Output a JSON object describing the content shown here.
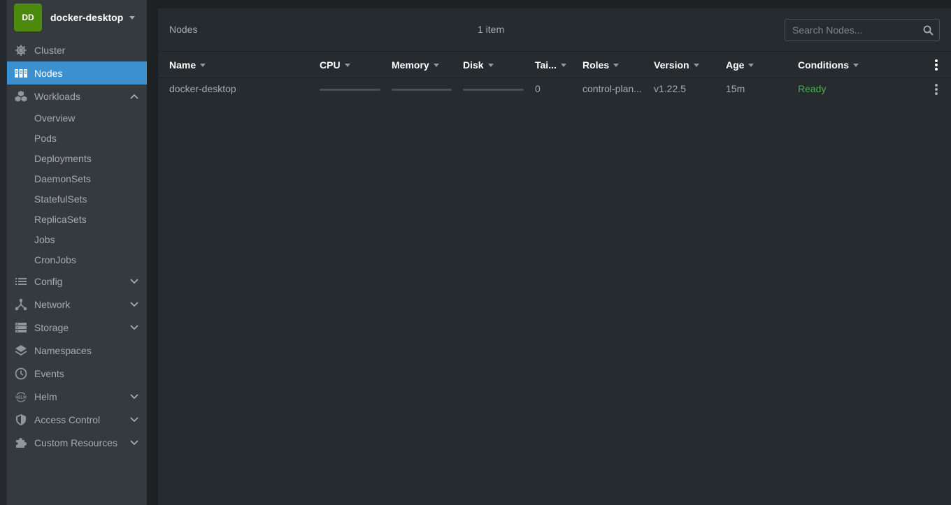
{
  "colors": {
    "avatar_bg": "#4c8a0e",
    "active_bg": "#3d90ce",
    "ready": "#4caf50"
  },
  "cluster": {
    "avatar": "DD",
    "name": "docker-desktop"
  },
  "sidebar": {
    "items": [
      {
        "label": "Cluster",
        "icon": "helm-wheel-icon"
      },
      {
        "label": "Nodes",
        "icon": "nodes-icon",
        "active": true
      },
      {
        "label": "Workloads",
        "icon": "workloads-icon",
        "expanded": true
      },
      {
        "label": "Config",
        "icon": "list-icon"
      },
      {
        "label": "Network",
        "icon": "network-icon"
      },
      {
        "label": "Storage",
        "icon": "storage-icon"
      },
      {
        "label": "Namespaces",
        "icon": "layers-icon"
      },
      {
        "label": "Events",
        "icon": "clock-icon"
      },
      {
        "label": "Helm",
        "icon": "helm-icon"
      },
      {
        "label": "Access Control",
        "icon": "shield-icon"
      },
      {
        "label": "Custom Resources",
        "icon": "puzzle-icon"
      }
    ],
    "workloads_sub": [
      "Overview",
      "Pods",
      "Deployments",
      "DaemonSets",
      "StatefulSets",
      "ReplicaSets",
      "Jobs",
      "CronJobs"
    ]
  },
  "header": {
    "title": "Nodes",
    "count": "1 item",
    "search_placeholder": "Search Nodes..."
  },
  "table": {
    "columns": [
      "Name",
      "CPU",
      "Memory",
      "Disk",
      "Tai...",
      "Roles",
      "Version",
      "Age",
      "Conditions"
    ],
    "rows": [
      {
        "name": "docker-desktop",
        "cpu_usage": 0,
        "memory_usage": 0,
        "disk_usage": 0,
        "taints": "0",
        "roles": "control-plan...",
        "version": "v1.22.5",
        "age": "15m",
        "conditions": "Ready"
      }
    ]
  }
}
